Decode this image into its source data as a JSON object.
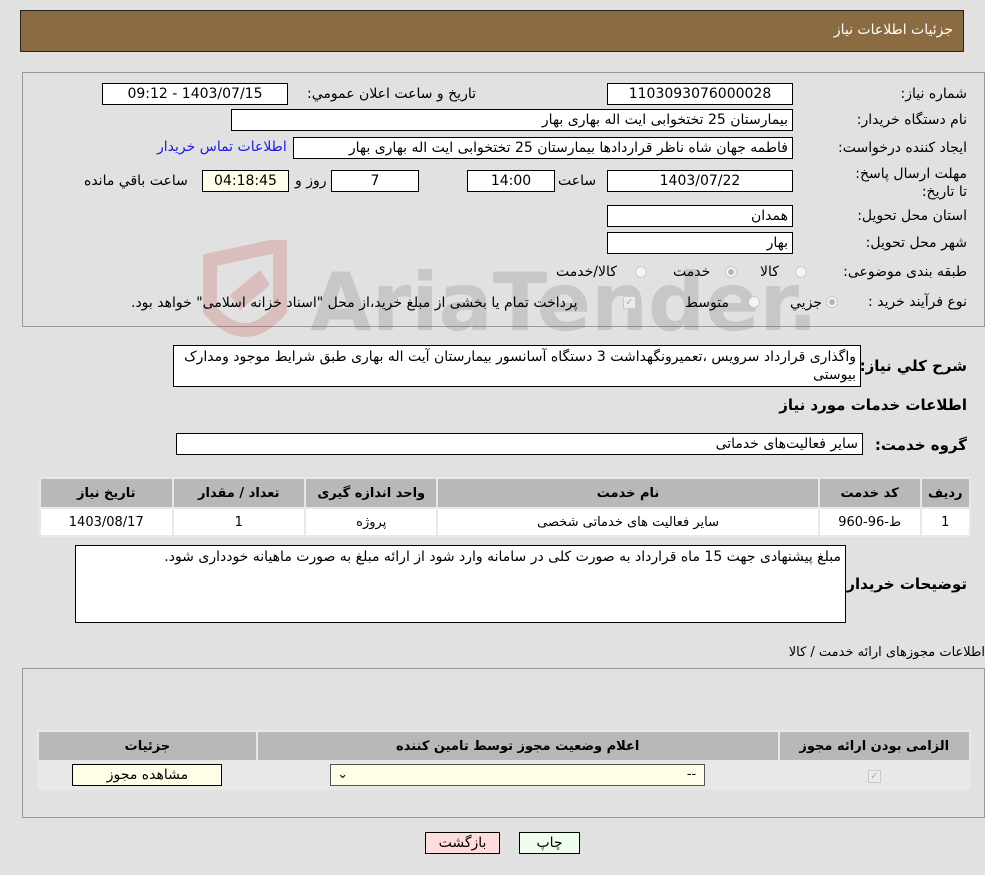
{
  "header": {
    "title": "جزئیات اطلاعات نیاز"
  },
  "form": {
    "need_number_label": "شماره نیاز:",
    "need_number": "1103093076000028",
    "announce_label": "تاریخ و ساعت اعلان عمومي:",
    "announce_value": "1403/07/15 - 09:12",
    "buyer_org_label": "نام دستگاه خریدار:",
    "buyer_org": "بیمارستان 25 تختخوابی ایت اله بهاری بهار",
    "creator_label": "ایجاد کننده درخواست:",
    "creator": "فاطمه جهان شاه ناظر قراردادها بیمارستان 25 تختخوابی ایت اله بهاری بهار",
    "contact_link": "اطلاعات تماس خریدار",
    "deadline_label": "مهلت ارسال پاسخ: تا تاریخ:",
    "deadline_date": "1403/07/22",
    "time_label": "ساعت",
    "deadline_time": "14:00",
    "days_value": "7",
    "days_label": "روز و",
    "remaining_time": "04:18:45",
    "remaining_label": "ساعت باقي مانده",
    "province_label": "استان محل تحویل:",
    "province": "همدان",
    "city_label": "شهر محل تحویل:",
    "city": "بهار",
    "category_label": "طبقه بندی موضوعی:",
    "category_options": [
      "کالا",
      "خدمت",
      "کالا/خدمت"
    ],
    "category_selected": "خدمت",
    "process_label": "نوع فرآیند خرید :",
    "process_options": [
      "جزيي",
      "متوسط"
    ],
    "process_selected": "جزيي",
    "treasury_note": "پرداخت تمام یا بخشی از مبلغ خرید،از محل \"اسناد خزانه اسلامی\" خواهد بود.",
    "treasury_checked": true
  },
  "description": {
    "label": "شرح كلي نياز:",
    "value": "واگذاری قرارداد سرویس ،تعمیرونگهداشت 3 دستگاه آسانسور بیمارستان آیت اله بهاری طبق شرایط موجود ومدارک بیوستی"
  },
  "services": {
    "section_title": "اطلاعات خدمات مورد نیاز",
    "group_label": "گروه خدمت:",
    "group_value": "سایر فعالیت‌های خدماتی",
    "columns": [
      "ردیف",
      "کد خدمت",
      "نام خدمت",
      "واحد اندازه گیری",
      "تعداد / مقدار",
      "تاریخ نیاز"
    ],
    "rows": [
      [
        "1",
        "ط-96-960",
        "سایر فعالیت های خدماتی شخصی",
        "پروژه",
        "1",
        "1403/08/17"
      ]
    ]
  },
  "buyer_notes": {
    "label": "توضیحات خریدار:",
    "value": "مبلغ پیشنهادی جهت 15 ماه قرارداد به صورت کلی در سامانه وارد شود از ارائه مبلغ به صورت ماهیانه خودداری شود."
  },
  "permits": {
    "section_title": "اطلاعات مجوزهای ارائه خدمت / کالا",
    "columns": [
      "الزامی بودن ارائه مجوز",
      "اعلام وضعیت مجوز توسط تامین کننده",
      "جزئیات"
    ],
    "rows": [
      {
        "required": true,
        "status_selected": "--",
        "details_button": "مشاهده مجوز"
      }
    ]
  },
  "buttons": {
    "print": "چاپ",
    "back": "بازگشت"
  },
  "colors": {
    "header_bg": "#8b6b42",
    "print_bg": "#eeffee",
    "back_bg": "#ffdddd",
    "link": "#1a1ae0"
  }
}
